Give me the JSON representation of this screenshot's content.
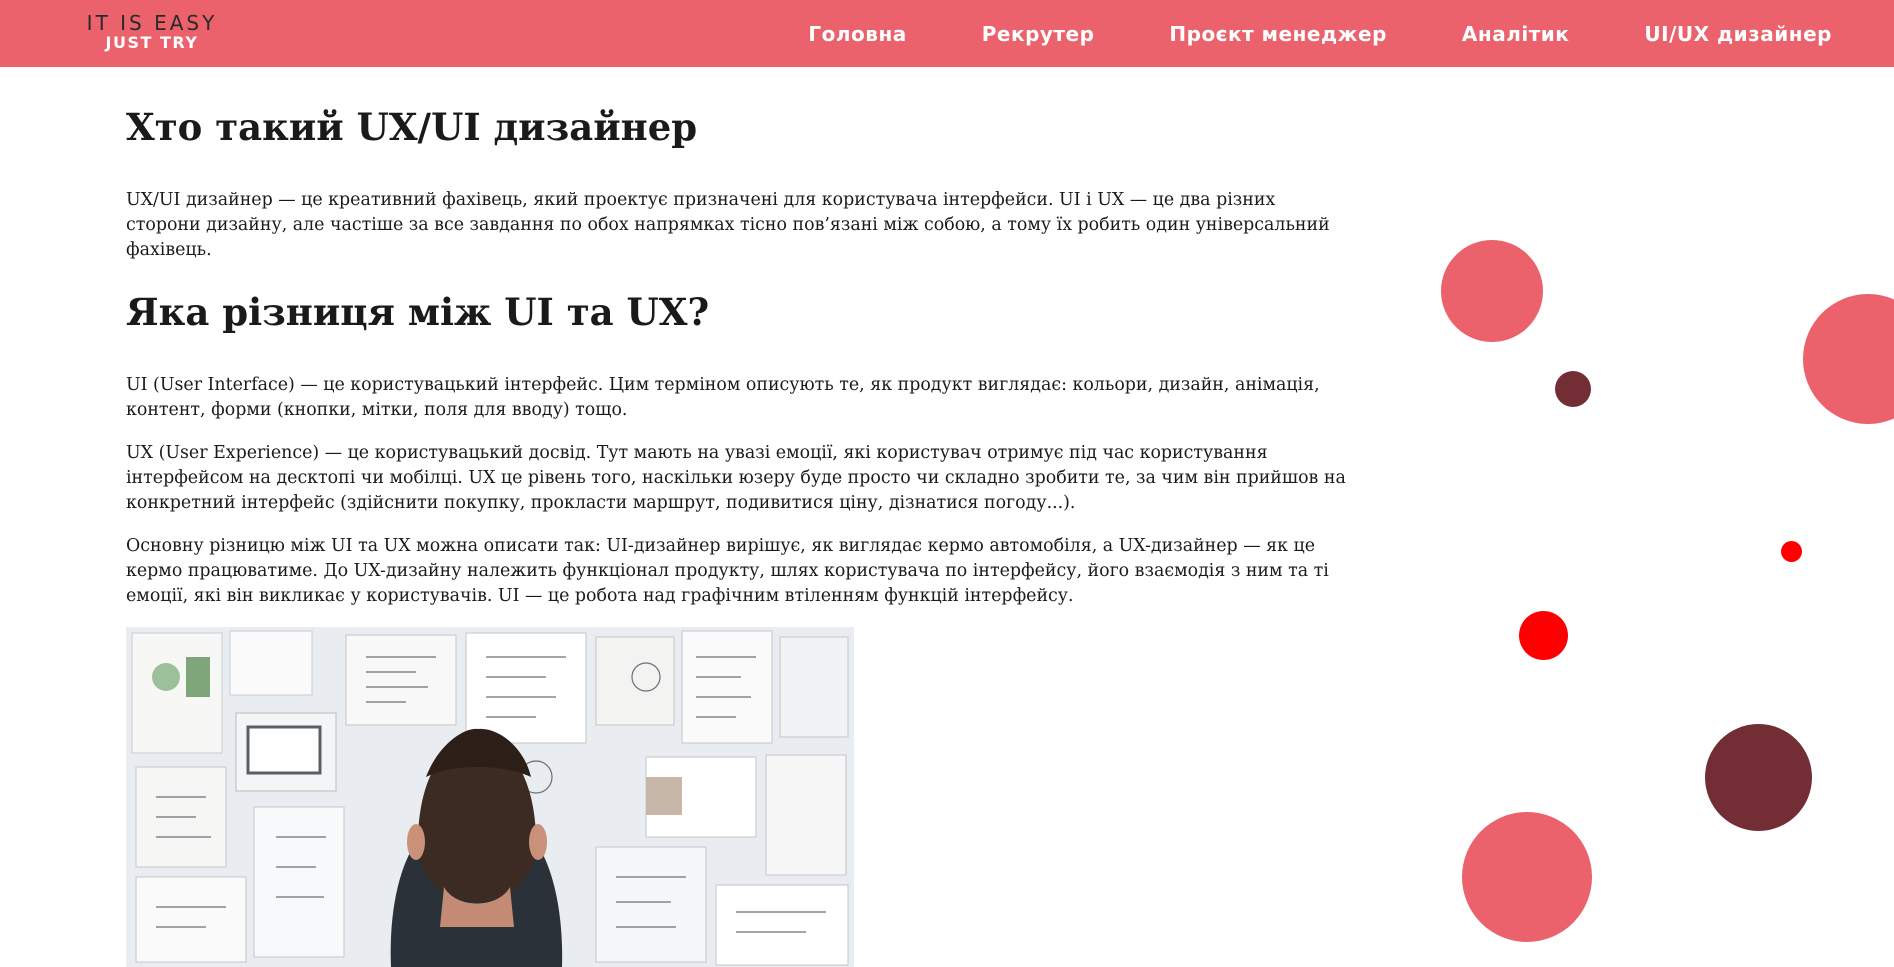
{
  "header": {
    "logo_top": "IT IS EASY",
    "logo_bottom": "JUST TRY",
    "nav": [
      {
        "label": "Головна"
      },
      {
        "label": "Рекрутер"
      },
      {
        "label": "Проєкт менеджер"
      },
      {
        "label": "Аналітик"
      },
      {
        "label": "UI/UX дизайнер"
      }
    ]
  },
  "article": {
    "heading1": "Хто такий UX/UI дизайнер",
    "para1": "UX/UI дизайнер — це креативний фахівець, який проектує призначені для користувача інтерфейси. UI і UX — це два різних сторони дизайну, але частіше за все завдання по обох напрямках тісно пов’язані між собою, а тому їх робить один універсальний фахівець.",
    "heading2": "Яка різниця між UI та UX?",
    "para2": "UI (User Interface) — це користувацький інтерфейс. Цим терміном описують те, як продукт виглядає: кольори, дизайн, анімація, контент, форми (кнопки, мітки, поля для вводу) тощо.",
    "para3": "UX (User Experience) — це користувацький досвід. Тут мають на увазі емоції, які користувач отримує під час користування інтерфейсом на десктопі чи мобілці. UX це рівень того, наскільки юзеру буде просто чи складно зробити те, за чим він прийшов на конкретний інтерфейс (здійснити покупку, прокласти маршрут, подивитися ціну, дізнатися погоду...).",
    "para4": "Основну різницю між UI та UX можна описати так: UI-дизайнер вирішує, як виглядає кермо автомобіля, а UX-дизайнер — як це кермо працюватиме. До UX-дизайну належить функціонал продукту, шлях користувача по інтерфейсу, його взаємодія з ним та ті емоції, які він викликає у користувачів. UI — це робота над графічним втіленням функцій інтерфейсу."
  },
  "colors": {
    "header_bg": "#eb616c",
    "circle_pink": "#eb616c",
    "circle_dark": "#722d35",
    "circle_red": "#ff0000"
  }
}
